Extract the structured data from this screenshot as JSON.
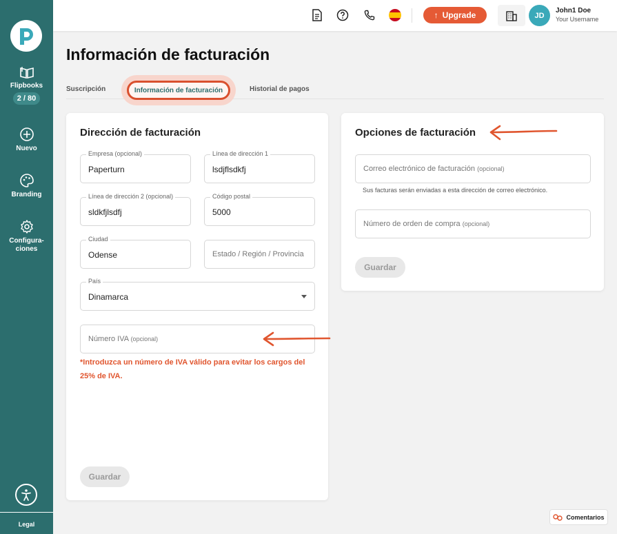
{
  "sidebar": {
    "items": [
      {
        "label": "Flipbooks",
        "count": "2 / 80"
      },
      {
        "label": "Nuevo"
      },
      {
        "label": "Branding"
      },
      {
        "label": "Configura-\nciones"
      }
    ],
    "legal": "Legal"
  },
  "header": {
    "upgrade_label": "Upgrade",
    "user_initials": "JD",
    "user_name": "John1 Doe",
    "user_subtitle": "Your Username"
  },
  "page": {
    "title": "Información de facturación",
    "tabs": [
      {
        "label": "Suscripción"
      },
      {
        "label": "Información de facturación",
        "active": true
      },
      {
        "label": "Historial de pagos"
      }
    ]
  },
  "billing_address": {
    "title": "Dirección de facturación",
    "fields": {
      "company": {
        "label": "Empresa (opcional)",
        "value": "Paperturn"
      },
      "address1": {
        "label": "Línea de dirección 1",
        "value": "lsdjflsdkfj"
      },
      "address2": {
        "label": "Línea de dirección 2 (opcional)",
        "value": "sldkfjlsdfj"
      },
      "postal": {
        "label": "Código postal",
        "value": "5000"
      },
      "city": {
        "label": "Ciudad",
        "value": "Odense"
      },
      "state": {
        "placeholder": "Estado / Región / Provincia"
      },
      "country": {
        "label": "País",
        "value": "Dinamarca"
      },
      "vat": {
        "placeholder": "Número IVA",
        "placeholder_suffix": "(opcional)"
      }
    },
    "warning": "*Introduzca un número de IVA válido para evitar los cargos del 25% de IVA.",
    "save_label": "Guardar"
  },
  "billing_options": {
    "title": "Opciones de facturación",
    "email": {
      "placeholder": "Correo electrónico de facturación",
      "placeholder_suffix": "(opcional)"
    },
    "email_hint": "Sus facturas serán enviadas a esta dirección de correo electrónico.",
    "po": {
      "placeholder": "Número de orden de compra",
      "placeholder_suffix": "(opcional)"
    },
    "save_label": "Guardar"
  },
  "feedback_label": "Comentarios",
  "colors": {
    "sidebar": "#2c6e6e",
    "accent": "#e55a35",
    "avatar": "#3aa9b9"
  }
}
